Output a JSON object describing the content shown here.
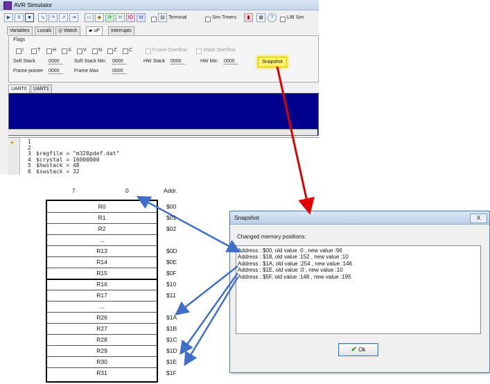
{
  "simulator": {
    "title": "AVR Simulator",
    "toolbar": {
      "play": "▶",
      "pause": "II",
      "stop": "■",
      "terminal": "Terminal",
      "sim_timers": "Sim Timers",
      "lib_sim": "LIB Sim"
    },
    "tabs": [
      "Variables",
      "Locals",
      "Watch",
      "uP",
      "Interrupts"
    ],
    "flags": {
      "title": "Flags",
      "bits": [
        "I",
        "T",
        "H",
        "S",
        "V",
        "N",
        "Z",
        "C"
      ],
      "frame_overflow": "Frame Overflow",
      "stack_overflow": "Stack Overflow"
    },
    "stats": {
      "soft_stack_label": "Soft Stack",
      "soft_stack_value": "0000",
      "soft_stack_min_label": "Soft Stack Min",
      "soft_stack_min_value": "0000",
      "hw_stack_label": "HW Stack",
      "hw_stack_value": "0000",
      "hw_min_label": "HW Min",
      "hw_min_value": "0000",
      "frame_pointer_label": "Frame pointer",
      "frame_pointer_value": "0000",
      "frame_max_label": "Frame Max",
      "frame_max_value": "0000"
    },
    "snapshot_button": "Snapshot",
    "uart_tabs": [
      "UART0",
      "UART1"
    ],
    "code": {
      "line_numbers": [
        "1",
        "2",
        "3",
        "4",
        "5",
        "6"
      ],
      "lines": [
        "",
        "",
        "$regfile = \"m328pdef.dat\"",
        "$crystal = 16000000",
        "$hwstack = 48",
        "$swstack = 32"
      ]
    }
  },
  "register_table": {
    "bit_high": "7",
    "bit_low": "0",
    "addr_header": "Addr.",
    "rows": [
      "R0",
      "R1",
      "R2",
      "...",
      "R13",
      "R14",
      "R15",
      "R16",
      "R17",
      "...",
      "R26",
      "R27",
      "R28",
      "R29",
      "R30",
      "R31"
    ],
    "addresses": [
      "$00",
      "$01",
      "$02",
      "",
      "$0D",
      "$0E",
      "$0F",
      "$10",
      "$11",
      "",
      "$1A",
      "$1B",
      "$1C",
      "$1D",
      "$1E",
      "$1F"
    ]
  },
  "snapshot_dialog": {
    "title": "Snapshot",
    "close_label": "X",
    "label": "Changed memory positions:",
    "changes": [
      "Address : $00, old value :0 , new value :96",
      "Address : $18, old value :152 , new value :10",
      "Address : $1A, old value :254 , new value :146",
      "Address : $1E, old value :0 , new value :10",
      "Address : $5F, old value :148 , new value :195"
    ],
    "ok_label": "Ok"
  },
  "colors": {
    "uart_background": "#00008e",
    "snapshot_highlight": "#fff36a",
    "red_arrow": "#e00000",
    "blue_arrow": "#3f6fc8"
  }
}
